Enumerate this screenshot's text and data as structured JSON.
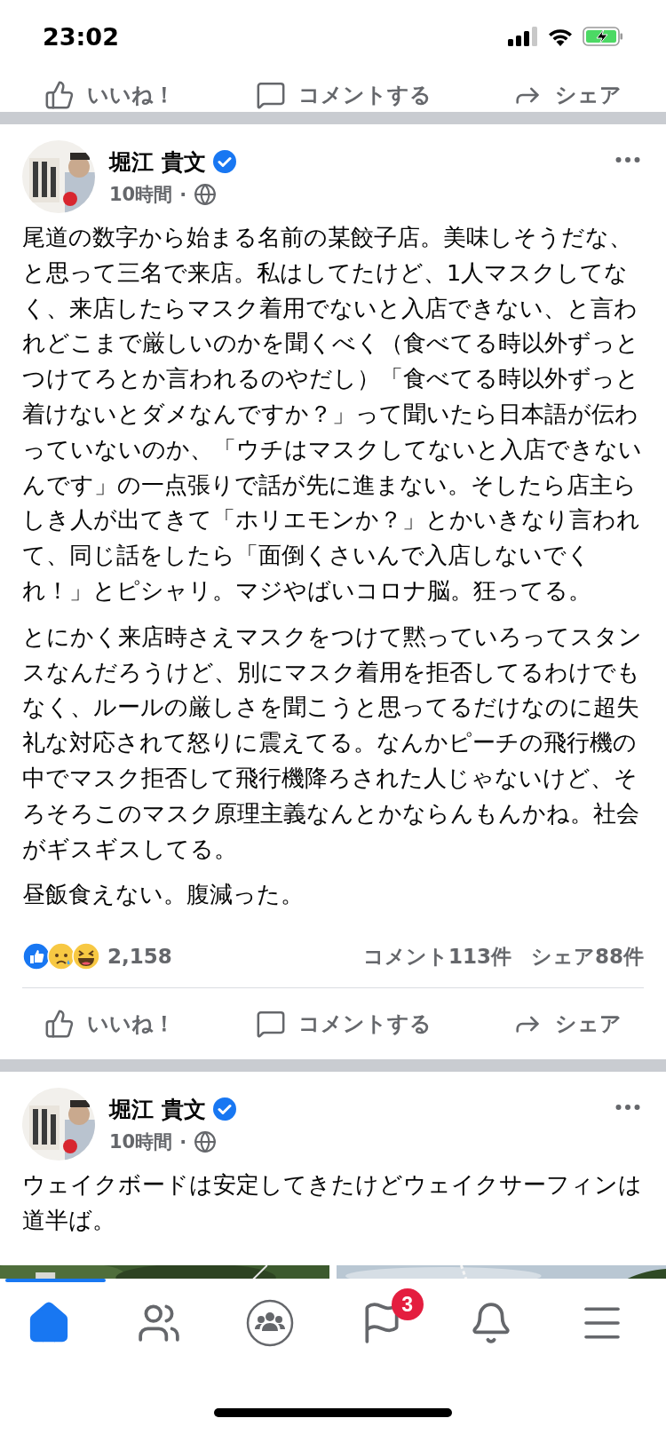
{
  "status_bar": {
    "time": "23:02"
  },
  "previous_post_actions": [
    {
      "kind": "like",
      "label": "いいね！"
    },
    {
      "kind": "comment",
      "label": "コメントする"
    },
    {
      "kind": "share",
      "label": "シェア"
    }
  ],
  "posts": [
    {
      "author": "堀江 貴文",
      "verified": true,
      "time": "10時間",
      "dot": "·",
      "paragraphs": [
        "尾道の数字から始まる名前の某餃子店。美味しそうだな、と思って三名で来店。私はしてたけど、1人マスクしてなく、来店したらマスク着用でないと入店できない、と言われどこまで厳しいのかを聞くべく（食べてる時以外ずっとつけてろとか言われるのやだし）「食べてる時以外ずっと着けないとダメなんですか？」って聞いたら日本語が伝わっていないのか、「ウチはマスクしてないと入店できないんです」の一点張りで話が先に進まない。そしたら店主らしき人が出てきて「ホリエモンか？」とかいきなり言われて、同じ話をしたら「面倒くさいんで入店しないでくれ！」とピシャリ。マジやばいコロナ脳。狂ってる。",
        "とにかく来店時さえマスクをつけて黙っていろってスタンスなんだろうけど、別にマスク着用を拒否してるわけでもなく、ルールの厳しさを聞こうと思ってるだけなのに超失礼な対応されて怒りに震えてる。なんかピーチの飛行機の中でマスク拒否して飛行機降ろされた人じゃないけど、そろそろこのマスク原理主義なんとかならんもんかね。社会がギスギスしてる。",
        "昼飯食えない。腹減った。"
      ],
      "reactions": {
        "icons": [
          {
            "kind": "like"
          },
          {
            "kind": "sad"
          },
          {
            "kind": "haha"
          }
        ],
        "count": "2,158"
      },
      "comments": "コメント113件",
      "shares": "シェア88件",
      "actions": [
        {
          "kind": "like",
          "label": "いいね！"
        },
        {
          "kind": "comment",
          "label": "コメントする"
        },
        {
          "kind": "share",
          "label": "シェア"
        }
      ]
    },
    {
      "author": "堀江 貴文",
      "verified": true,
      "time": "10時間",
      "dot": "·",
      "paragraphs": [
        "ウェイクボードは安定してきたけどウェイクサーフィンは道半ば。"
      ],
      "photos": [
        {
          "kind": "picture"
        },
        {
          "kind": "picture"
        }
      ]
    }
  ],
  "nav": [
    {
      "kind": "home",
      "selected": true
    },
    {
      "kind": "friends",
      "selected": false
    },
    {
      "kind": "groups",
      "selected": false
    },
    {
      "kind": "pages",
      "selected": false,
      "badge": "3"
    },
    {
      "kind": "notifications",
      "selected": false
    },
    {
      "kind": "menu",
      "selected": false
    }
  ]
}
